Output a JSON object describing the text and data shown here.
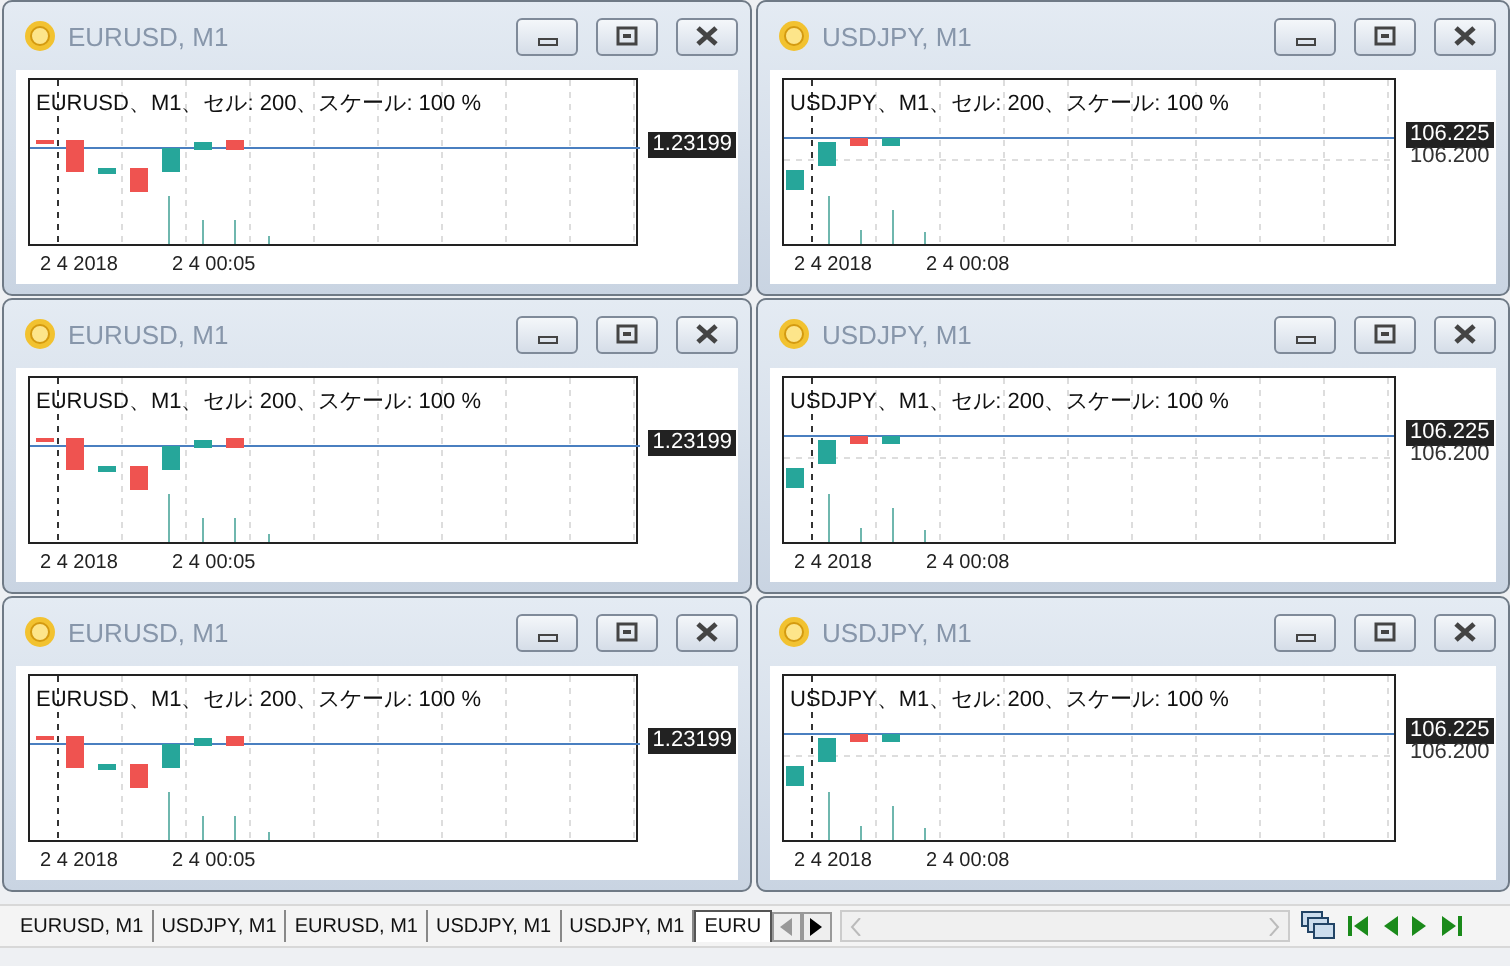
{
  "windows": [
    {
      "title": "EURUSD, M1",
      "kind": "eurusd",
      "caption": "EURUSD、M1、セル: 200、スケール: 100 %",
      "price_labels": [
        {
          "text": "1.23199",
          "kind": "current"
        }
      ],
      "time_labels": [
        "2 4 2018",
        "2 4 00:05"
      ]
    },
    {
      "title": "USDJPY, M1",
      "kind": "usdjpy",
      "caption": "USDJPY、M1、セル: 200、スケール: 100 %",
      "price_labels": [
        {
          "text": "106.225",
          "kind": "current"
        },
        {
          "text": "106.200",
          "kind": "level"
        }
      ],
      "time_labels": [
        "2 4 2018",
        "2 4 00:08"
      ]
    },
    {
      "title": "EURUSD, M1",
      "kind": "eurusd",
      "caption": "EURUSD、M1、セル: 200、スケール: 100 %",
      "price_labels": [
        {
          "text": "1.23199",
          "kind": "current"
        }
      ],
      "time_labels": [
        "2 4 2018",
        "2 4 00:05"
      ]
    },
    {
      "title": "USDJPY, M1",
      "kind": "usdjpy",
      "caption": "USDJPY、M1、セル: 200、スケール: 100 %",
      "price_labels": [
        {
          "text": "106.225",
          "kind": "current"
        },
        {
          "text": "106.200",
          "kind": "level"
        }
      ],
      "time_labels": [
        "2 4 2018",
        "2 4 00:08"
      ]
    },
    {
      "title": "EURUSD, M1",
      "kind": "eurusd",
      "caption": "EURUSD、M1、セル: 200、スケール: 100 %",
      "price_labels": [
        {
          "text": "1.23199",
          "kind": "current"
        }
      ],
      "time_labels": [
        "2 4 2018",
        "2 4 00:05"
      ]
    },
    {
      "title": "USDJPY, M1",
      "kind": "usdjpy",
      "caption": "USDJPY、M1、セル: 200、スケール: 100 %",
      "price_labels": [
        {
          "text": "106.225",
          "kind": "current"
        },
        {
          "text": "106.200",
          "kind": "level"
        }
      ],
      "time_labels": [
        "2 4 2018",
        "2 4 00:08"
      ]
    }
  ],
  "tabs": [
    {
      "label": "EURUSD, M1",
      "selected": false
    },
    {
      "label": "USDJPY, M1",
      "selected": false
    },
    {
      "label": "EURUSD, M1",
      "selected": false
    },
    {
      "label": "USDJPY, M1",
      "selected": false
    },
    {
      "label": "USDJPY, M1",
      "selected": false
    },
    {
      "label": "EURU",
      "selected": true
    }
  ]
}
